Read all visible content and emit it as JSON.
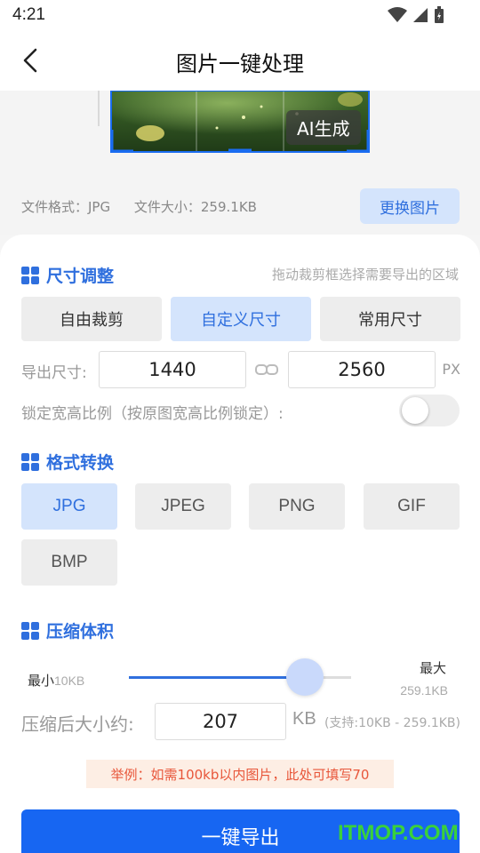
{
  "status_bar": {
    "time": "4:21"
  },
  "header": {
    "title": "图片一键处理"
  },
  "preview": {
    "ai_badge": "AI生成",
    "format_label": "文件格式：JPG",
    "size_label": "文件大小：259.1KB",
    "change_button": "更换图片"
  },
  "size_section": {
    "title": "尺寸调整",
    "hint": "拖动裁剪框选择需要导出的区域",
    "tabs": [
      {
        "label": "自由裁剪",
        "active": false
      },
      {
        "label": "自定义尺寸",
        "active": true
      },
      {
        "label": "常用尺寸",
        "active": false
      }
    ],
    "export_size_label": "导出尺寸:",
    "width": "1440",
    "height": "2560",
    "unit": "PX",
    "lock_label": "锁定宽高比例（按原图宽高比例锁定）:",
    "lock_enabled": false
  },
  "format_section": {
    "title": "格式转换",
    "options": [
      {
        "label": "JPG",
        "active": true
      },
      {
        "label": "JPEG",
        "active": false
      },
      {
        "label": "PNG",
        "active": false
      },
      {
        "label": "GIF",
        "active": false
      },
      {
        "label": "BMP",
        "active": false
      }
    ]
  },
  "compress_section": {
    "title": "压缩体积",
    "min_label": "最小",
    "min_value": "10KB",
    "max_label": "最大",
    "max_value": "259.1KB",
    "slider_fraction": 0.79,
    "target_label": "压缩后大小约:",
    "target_value": "207",
    "target_unit": "KB",
    "range_hint": "(支持:10KB - 259.1KB)",
    "tip": "举例：如需100kb以内图片，此处可填写70"
  },
  "export_button": "一键导出",
  "watermark": "ITMOP.COM",
  "colors": {
    "accent": "#2f6fde",
    "accent_light": "#d4e4fc",
    "primary_button": "#1766f2"
  }
}
